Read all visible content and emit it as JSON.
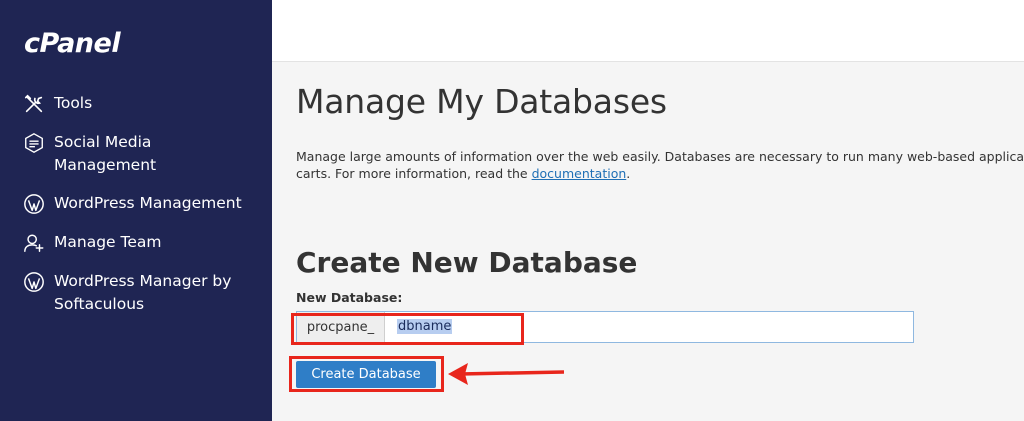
{
  "sidebar": {
    "logo": "cPanel",
    "items": [
      {
        "label": "Tools",
        "icon": "tools-icon"
      },
      {
        "label": "Social Media\nManagement",
        "icon": "social-media-icon"
      },
      {
        "label": "WordPress Management",
        "icon": "wordpress-icon"
      },
      {
        "label": "Manage Team",
        "icon": "team-icon"
      },
      {
        "label": "WordPress Manager by\nSoftaculous",
        "icon": "wordpress-icon"
      }
    ]
  },
  "main": {
    "title": "Manage My Databases",
    "description_line1": "Manage large amounts of information over the web easily. Databases are necessary to run many web-based applicati",
    "description_line2_prefix": "carts. For more information, read the ",
    "description_link": "documentation",
    "description_line2_suffix": ".",
    "create_section": {
      "title": "Create New Database",
      "field_label": "New Database:",
      "prefix": "procpane_",
      "value": "dbname",
      "button_label": "Create Database"
    }
  },
  "annotations": {
    "highlight_color": "#e8261c"
  }
}
